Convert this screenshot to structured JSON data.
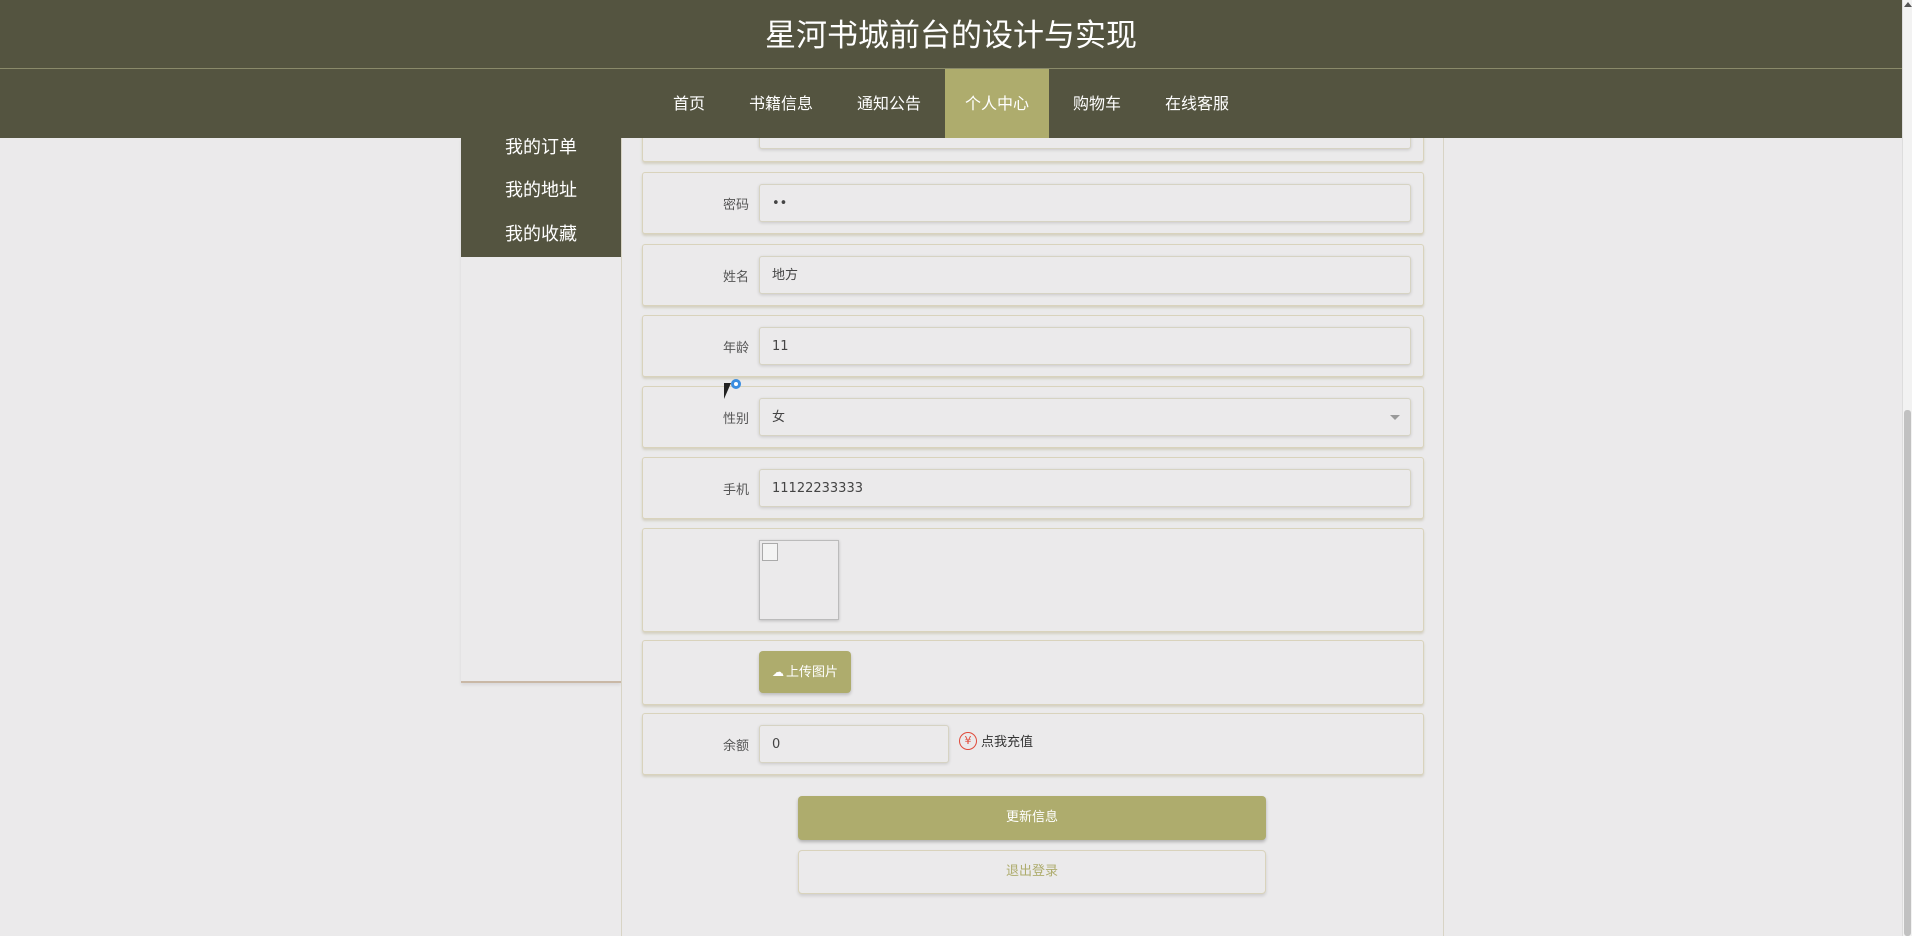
{
  "header": {
    "title": "星河书城前台的设计与实现"
  },
  "nav": [
    {
      "label": "首页",
      "active": false
    },
    {
      "label": "书籍信息",
      "active": false
    },
    {
      "label": "通知公告",
      "active": false
    },
    {
      "label": "个人中心",
      "active": true
    },
    {
      "label": "购物车",
      "active": false
    },
    {
      "label": "在线客服",
      "active": false
    }
  ],
  "side_menu": [
    "我的订单",
    "我的地址",
    "我的收藏"
  ],
  "form": {
    "password": {
      "label": "密码",
      "value": "••"
    },
    "name": {
      "label": "姓名",
      "value": "地方"
    },
    "age": {
      "label": "年龄",
      "value": "11"
    },
    "gender": {
      "label": "性别",
      "value": "女"
    },
    "phone": {
      "label": "手机",
      "value": "11122233333"
    },
    "upload_label": "上传图片",
    "balance": {
      "label": "余额",
      "value": "0"
    },
    "recharge_label": "点我充值",
    "recharge_icon": "¥"
  },
  "buttons": {
    "update": "更新信息",
    "logout": "退出登录"
  },
  "colors": {
    "header_bg": "#545440",
    "accent": "#aeac6d",
    "page_bg": "#ebeaeb"
  }
}
